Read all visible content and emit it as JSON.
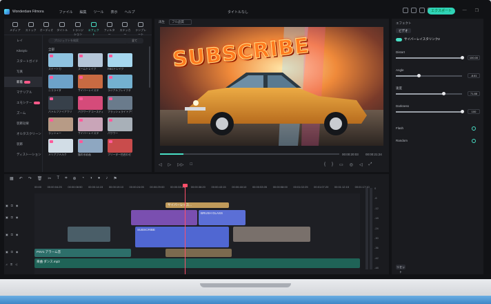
{
  "titlebar": {
    "app_name": "Wonderdare Filmora",
    "menu": [
      "ファイル",
      "編集",
      "ツール",
      "表示",
      "ヘルプ"
    ],
    "doc_title": "タイトルなし",
    "export_label": "エクスポート"
  },
  "library": {
    "tabs": [
      "メディア",
      "ストック",
      "オーディオ",
      "タイトル",
      "トランジション",
      "エフェクト",
      "フィルター",
      "ステッカー",
      "テンプレート"
    ],
    "active_tab": "エフェクト",
    "sidebar": [
      "レイ",
      "Kikstylo",
      "スタートガイド",
      "写真",
      "新着",
      "マテリアル",
      "エモシナー",
      "ズーム",
      "装飾効果",
      "オルタスクリーン",
      "装飾",
      "ディスト―ション"
    ],
    "active_sidebar": "新着",
    "search_placeholder": "プロジェクトを検索",
    "filter_label": "全て",
    "section_title": "全部",
    "items": [
      {
        "caption": "ステートカ",
        "color": "#8fc3e0"
      },
      {
        "caption": "ズームトレイク",
        "color": "#b5c6d8"
      },
      {
        "caption": "RBGトレイク",
        "color": "#a6d7ef"
      },
      {
        "caption": "ニコライダ",
        "color": "#6da2c9"
      },
      {
        "caption": "サイバーレイスタ",
        "color": "#c86a42"
      },
      {
        "caption": "ラジアルブレイクタ",
        "color": "#74b1d0"
      },
      {
        "caption": "パトルファイアワリ",
        "color": "#37404a"
      },
      {
        "caption": "パワサーアコースティ",
        "color": "#d54b7a"
      },
      {
        "caption": "フラッシュライトアウト",
        "color": "#6a7b8c"
      },
      {
        "caption": "ラッシュー",
        "color": "#b79b86"
      },
      {
        "caption": "サイバーレイスタ",
        "color": "#c9a5b8"
      },
      {
        "caption": "パワワー",
        "color": "#a8b0b8"
      },
      {
        "caption": "メリアプメルク",
        "color": "#d2dde6"
      },
      {
        "caption": "猫の水彩画",
        "color": "#8ea7c1"
      },
      {
        "caption": "フリーダー色合わせ",
        "color": "#c94c4c"
      }
    ]
  },
  "viewer": {
    "label": "再生",
    "quality": "フル品質",
    "title_text": "SUBSCRIBE",
    "current_time": "00:00:20:03",
    "total_time": "00:00:21:24"
  },
  "properties": {
    "tab": "エフェクト",
    "chip": "ビデオ",
    "effect_name": "サイバーレイスタリンク2",
    "params": [
      {
        "label": "Distort",
        "value": "100.00",
        "level": 1.0
      },
      {
        "label": "Angle",
        "value": "-8.61",
        "level": 0.35
      },
      {
        "label": "速度",
        "value": "71.88",
        "level": 0.72
      },
      {
        "label": "Darkness",
        "value": "100",
        "level": 1.0
      }
    ],
    "flash_label": "Flash",
    "random_label": "Random",
    "reset_label": "リセット"
  },
  "timeline": {
    "ruler": [
      "00:00",
      "00:00:04:25",
      "00:00:08:50",
      "00:00:14:15",
      "00:00:19:10",
      "00:00:24:05",
      "00:00:29:00",
      "00:00:33:25",
      "00:00:38:20",
      "00:00:43:15",
      "00:00:48:10",
      "00:00:53:05",
      "00:00:58:00",
      "00:01:02:25",
      "00:01:07:20",
      "00:01:12:15",
      "00:01:17:10"
    ],
    "meter_scale": [
      "0",
      "-6",
      "-12",
      "-18",
      "-24",
      "-30",
      "-36",
      "-42",
      "-48"
    ],
    "clips": {
      "effect_clip": "サイバーレイス...",
      "brush_glass": "BRUSH GLASS",
      "subscribe": "SUBSCRIBE",
      "audio1": "PSV1 アラーム音",
      "audio2": "楽曲 ダンス.mp3"
    },
    "tracks": [
      "4",
      "3",
      "2",
      "1",
      "1"
    ]
  }
}
